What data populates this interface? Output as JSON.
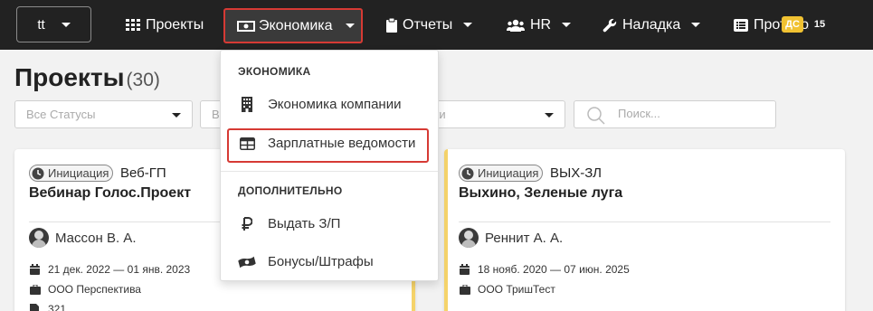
{
  "nav": {
    "user_label": "tt",
    "items": [
      {
        "label": "Проекты",
        "icon": "grid-icon"
      },
      {
        "label": "Экономика",
        "icon": "money-icon"
      },
      {
        "label": "Отчеты",
        "icon": "clipboard-icon"
      },
      {
        "label": "HR",
        "icon": "users-icon"
      },
      {
        "label": "Наладка",
        "icon": "wrench-icon"
      },
      {
        "label": "Протоколы",
        "icon": "list-icon"
      }
    ],
    "colors": {
      "bar": "#222222",
      "active_outline": "#d63a34"
    }
  },
  "page": {
    "title": "Проекты",
    "count": "(30)"
  },
  "filters": {
    "status": "Все Статусы",
    "second": "В",
    "customers": "азчики",
    "search_placeholder": "Поиск..."
  },
  "dropdown": {
    "section1_header": "ЭКОНОМИКА",
    "section1_items": [
      {
        "label": "Экономика компании",
        "icon": "building-icon"
      },
      {
        "label": "Зарплатные ведомости",
        "icon": "table-icon"
      }
    ],
    "section2_header": "ДОПОЛНИТЕЛЬНО",
    "section2_items": [
      {
        "label": "Выдать З/П",
        "icon": "ruble-icon"
      },
      {
        "label": "Бонусы/Штрафы",
        "icon": "money-bill-wave-icon"
      }
    ]
  },
  "cards": [
    {
      "status": "Инициация",
      "code": "Веб-ГП",
      "title": "Вебинар Голос.Проект",
      "manager": "Массон В. А.",
      "dates": "21 дек. 2022 — 01 янв. 2023",
      "company": "ООО Перспектива",
      "extra": "321"
    },
    {
      "status": "Инициация",
      "code": "ВЫХ-ЗЛ",
      "title": "Выхино, Зеленые луга",
      "manager": "Реннит А. А.",
      "dates": "18 нояб. 2020 — 07 июн. 2025",
      "company": "ООО ТришТест",
      "badge_ds": "ДС",
      "badge_count": "15"
    }
  ]
}
